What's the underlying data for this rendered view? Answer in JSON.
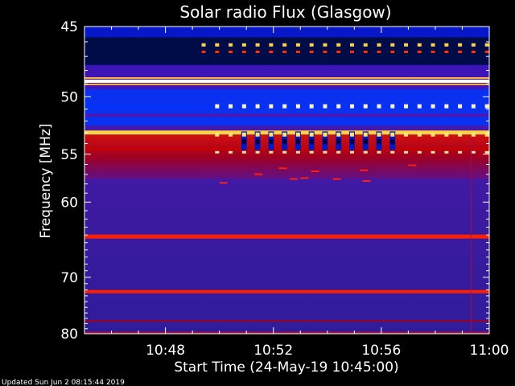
{
  "chart_data": {
    "type": "heatmap",
    "title": "Solar radio Flux (Glasgow)",
    "ylabel": "Frequency [MHz]",
    "xlabel": "Start Time (24-May-19 10:45:00)",
    "x_ticks": [
      "10:48",
      "10:52",
      "10:56",
      "11:00"
    ],
    "x_tick_minutes": [
      3,
      7,
      11,
      15
    ],
    "xlim_minutes": [
      0,
      15
    ],
    "y_ticks": [
      "45",
      "50",
      "55",
      "60",
      "70",
      "80"
    ],
    "y_tick_values": [
      45,
      50,
      55,
      60,
      70,
      80
    ],
    "ylim": [
      45,
      80
    ],
    "y_scale": "reciprocal",
    "colormap": {
      "background": "#3a1aa8",
      "low": "#0000ff",
      "high": "#ff0000",
      "peak": "#ffffff"
    },
    "features": [
      {
        "kind": "band",
        "freq": 46.5,
        "color": "#001060"
      },
      {
        "kind": "band",
        "freq": 48.8,
        "color": "#ffffff"
      },
      {
        "kind": "band",
        "freq": 50.8,
        "color": "#0030ff"
      },
      {
        "kind": "band",
        "freq": 53.0,
        "color": "#ffd040"
      },
      {
        "kind": "band",
        "freq": 54.5,
        "color": "#c80000"
      },
      {
        "kind": "band",
        "freq": 64.2,
        "color": "#ff2000"
      },
      {
        "kind": "band",
        "freq": 72.3,
        "color": "#ff2000"
      },
      {
        "kind": "band",
        "freq": 77.5,
        "color": "#a00020"
      },
      {
        "kind": "band",
        "freq": 79.8,
        "color": "#c01030"
      }
    ],
    "grid": false
  },
  "footer": {
    "updated": "Updated Sun Jun  2 08:15:44 2019"
  }
}
